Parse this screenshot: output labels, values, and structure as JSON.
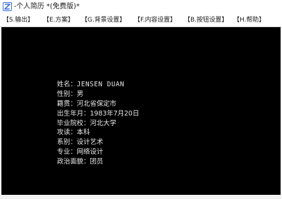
{
  "window": {
    "title": "-个人简历 *(免费版)*"
  },
  "menu": {
    "items": [
      {
        "label": "【S.输出】"
      },
      {
        "label": "【E.方案】"
      },
      {
        "label": "【G.背景设置】"
      },
      {
        "label": "【F.内容设置】"
      },
      {
        "label": "【B.按钮设置】"
      },
      {
        "label": "【H.帮助】"
      }
    ]
  },
  "resume": {
    "lines": [
      {
        "label": "姓名：",
        "value": "JENSEN DUAN"
      },
      {
        "label": "性别：",
        "value": "男"
      },
      {
        "label": "籍贯：",
        "value": "河北省保定市"
      },
      {
        "label": "出生年月：",
        "value": "1983年7月20日"
      },
      {
        "label": "毕业院校：",
        "value": "河北大学"
      },
      {
        "label": "攻读：",
        "value": "本科"
      },
      {
        "label": "系别：",
        "value": "设计艺术"
      },
      {
        "label": "专业：",
        "value": "网络设计"
      },
      {
        "label": "政治面貌：",
        "value": "团员"
      }
    ]
  },
  "colors": {
    "console_background": "#000000",
    "console_text": "#e6e6e6",
    "chrome_background": "#ffffff",
    "app_icon": "#3a6fd8"
  },
  "icons": {
    "app": "app-logo-icon"
  }
}
